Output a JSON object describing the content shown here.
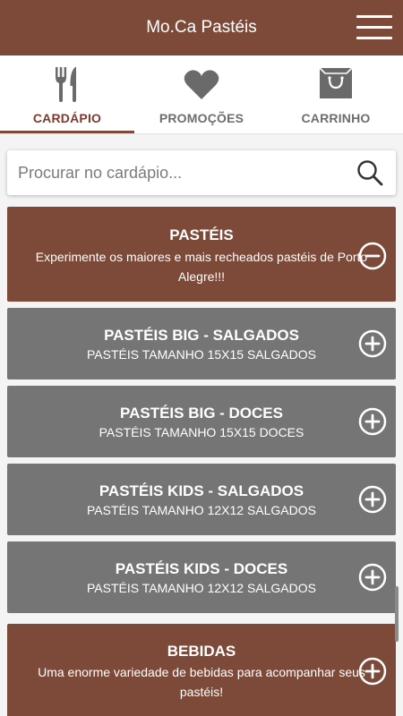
{
  "app": {
    "title": "Mo.Ca Pastéis"
  },
  "tabs": [
    {
      "label": "CARDÁPIO",
      "icon": "fork-knife-icon",
      "active": true
    },
    {
      "label": "PROMOÇÕES",
      "icon": "heart-icon",
      "active": false
    },
    {
      "label": "CARRINHO",
      "icon": "shopping-bag-icon",
      "active": false
    }
  ],
  "search": {
    "placeholder": "Procurar no cardápio...",
    "value": ""
  },
  "categories": [
    {
      "title": "PASTÉIS",
      "description": "Experimente os maiores e mais recheados pastéis de Porto Alegre!!!",
      "expanded": true,
      "icon": "minus-circle-icon"
    },
    {
      "title": "PASTÉIS BIG - SALGADOS",
      "description": "PASTÉIS TAMANHO 15X15 SALGADOS",
      "expanded": false,
      "icon": "plus-circle-icon"
    },
    {
      "title": "PASTÉIS BIG - DOCES",
      "description": "PASTÉIS TAMANHO 15X15 DOCES",
      "expanded": false,
      "icon": "plus-circle-icon"
    },
    {
      "title": "PASTÉIS KIDS - SALGADOS",
      "description": "PASTÉIS TAMANHO 12X12 SALGADOS",
      "expanded": false,
      "icon": "plus-circle-icon"
    },
    {
      "title": "PASTÉIS KIDS - DOCES",
      "description": "PASTÉIS TAMANHO 12X12 SALGADOS",
      "expanded": false,
      "icon": "plus-circle-icon"
    },
    {
      "title": "BEBIDAS",
      "description": "Uma enorme variedade de bebidas para acompanhar seus pastéis!",
      "expanded": false,
      "icon": "plus-circle-icon"
    }
  ],
  "colors": {
    "brand": "#7d4a39",
    "category_gray": "#757575",
    "active_tab": "#7d3a2c",
    "inactive_tab": "#6d6d6d",
    "background": "#f4f4f4"
  }
}
